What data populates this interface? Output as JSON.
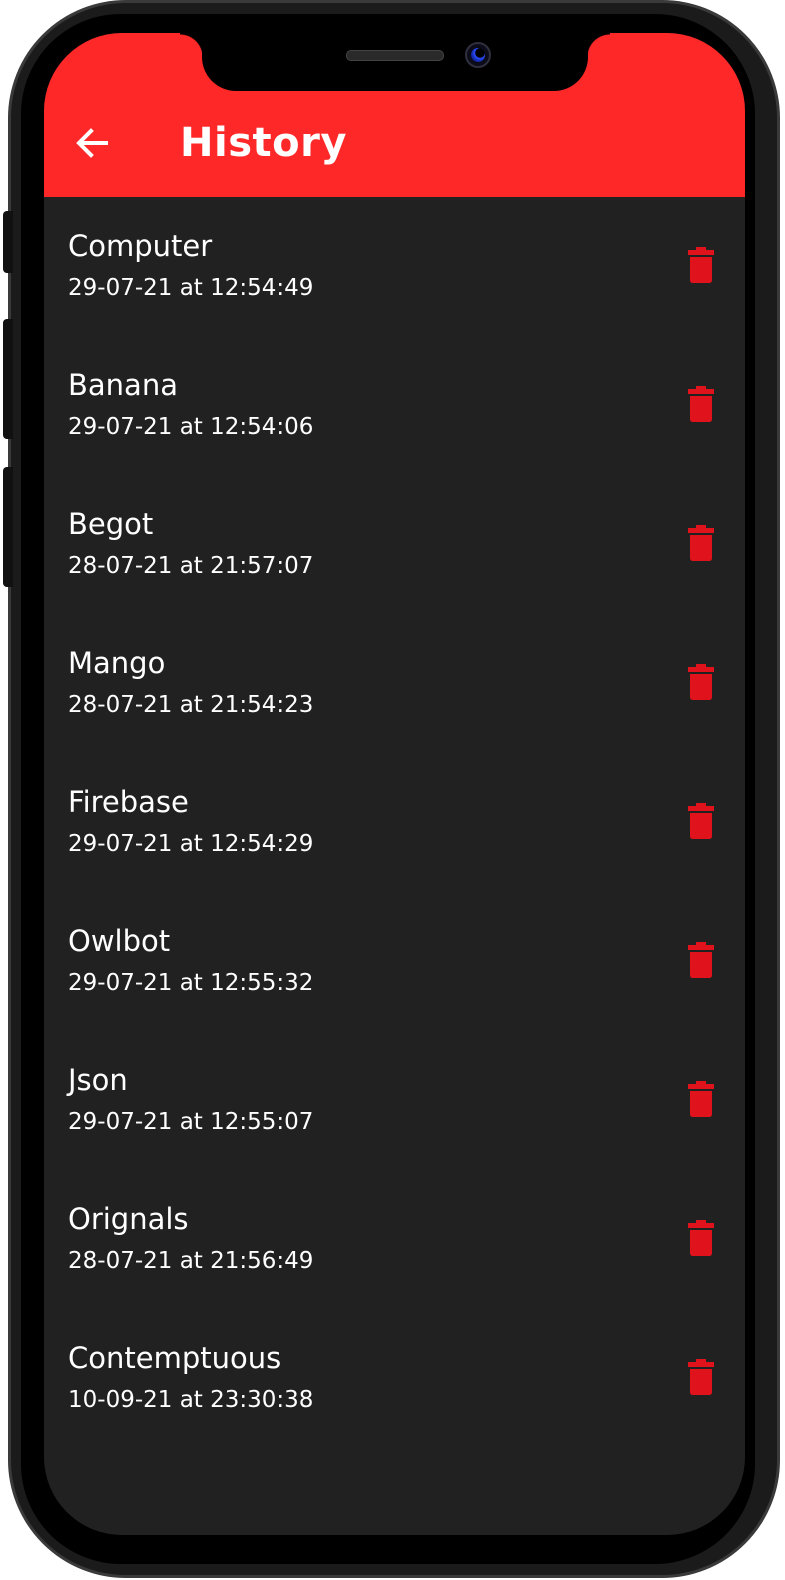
{
  "app_bar": {
    "title": "History",
    "background_color": "#ff2828",
    "back_icon": "arrow-left-icon"
  },
  "history": {
    "delete_icon": "trash-icon",
    "delete_color": "#e0121b",
    "items": [
      {
        "word": "Computer",
        "timestamp": "29-07-21 at 12:54:49"
      },
      {
        "word": "Banana",
        "timestamp": "29-07-21 at 12:54:06"
      },
      {
        "word": "Begot",
        "timestamp": "28-07-21 at 21:57:07"
      },
      {
        "word": "Mango",
        "timestamp": "28-07-21 at 21:54:23"
      },
      {
        "word": "Firebase",
        "timestamp": "29-07-21 at 12:54:29"
      },
      {
        "word": "Owlbot",
        "timestamp": "29-07-21 at 12:55:32"
      },
      {
        "word": "Json",
        "timestamp": "29-07-21 at 12:55:07"
      },
      {
        "word": "Orignals",
        "timestamp": "28-07-21 at 21:56:49"
      },
      {
        "word": "Contemptuous",
        "timestamp": "10-09-21 at 23:30:38"
      }
    ]
  }
}
